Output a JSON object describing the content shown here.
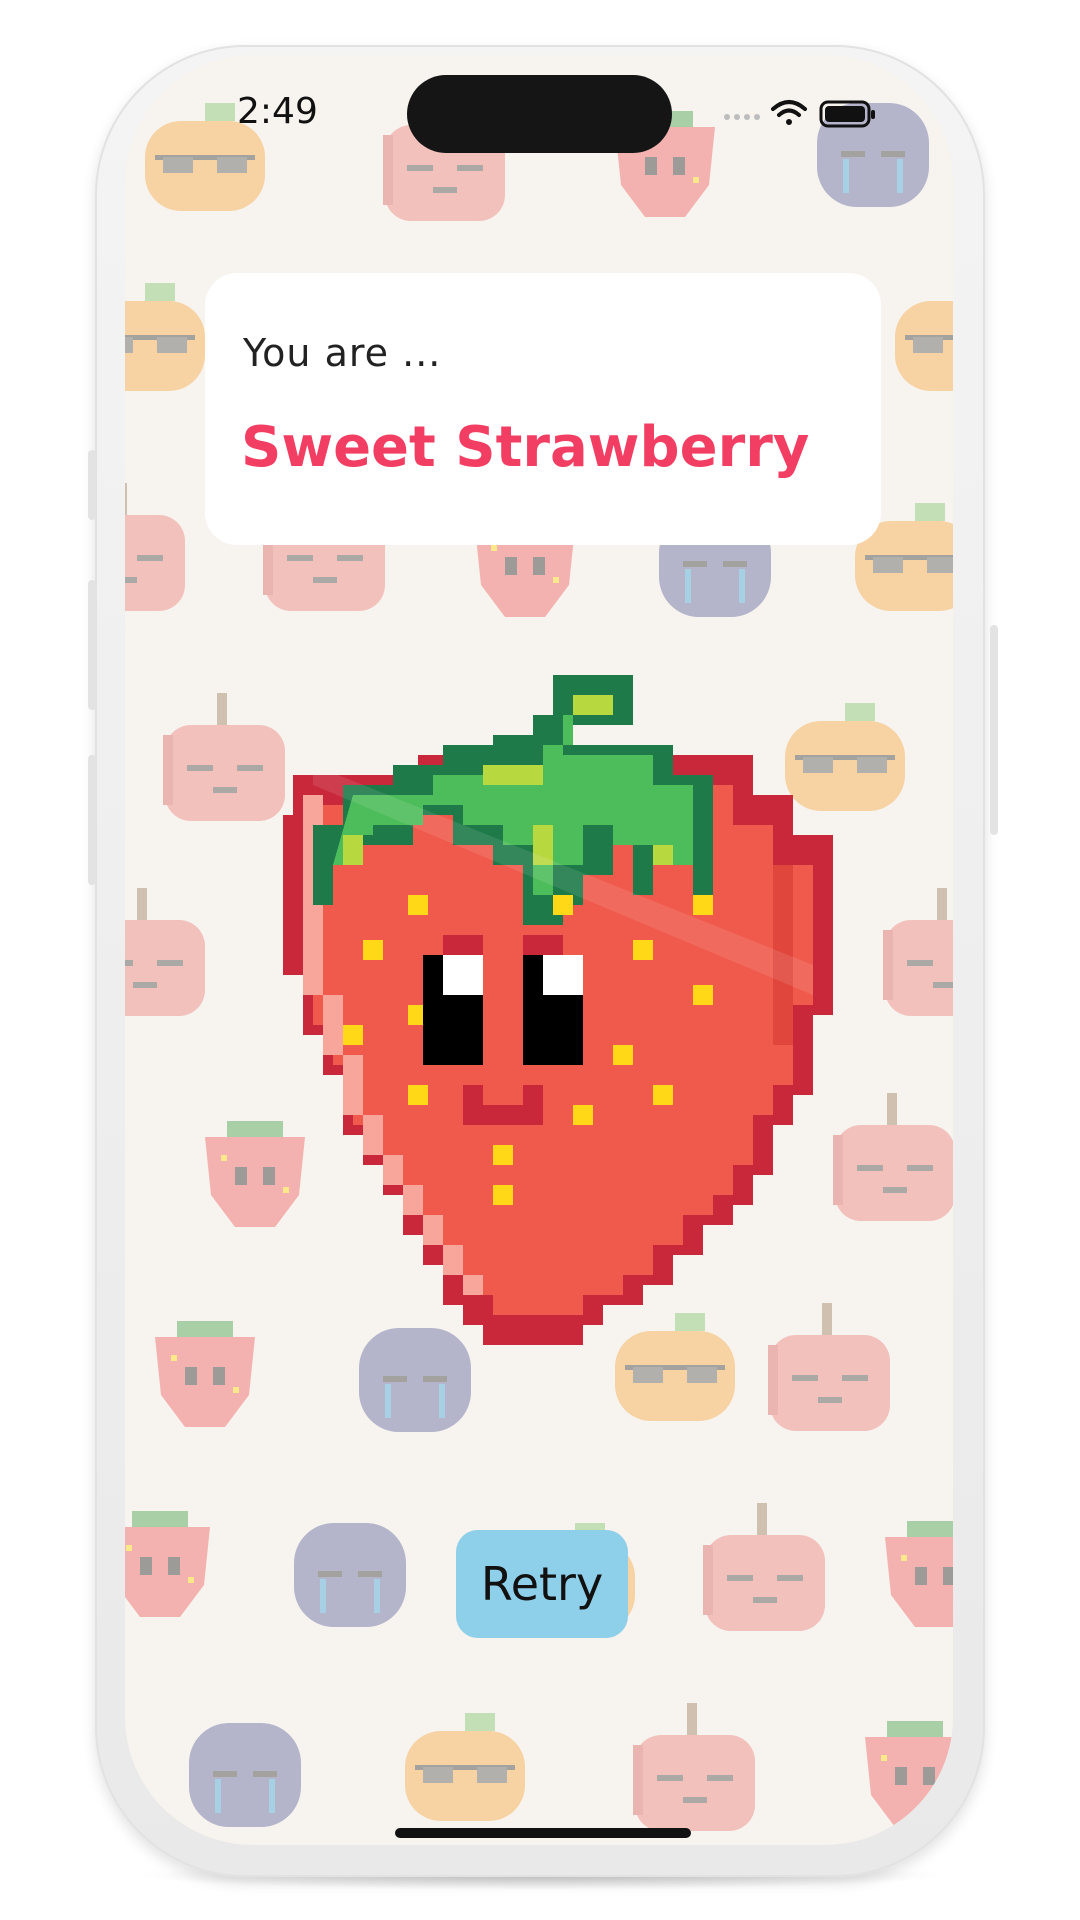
{
  "status_bar": {
    "time": "2:49",
    "icons": [
      "cellular-dots-icon",
      "wifi-icon",
      "battery-icon"
    ]
  },
  "result": {
    "prefix": "You are ...",
    "title": "Sweet Strawberry"
  },
  "hero_image": "strawberry-pixel-icon",
  "actions": {
    "retry_label": "Retry"
  },
  "background_pattern": [
    "apple-pixel-icon",
    "strawberry-pixel-icon",
    "orange-sunglasses-pixel-icon",
    "blueberry-crying-pixel-icon"
  ],
  "colors": {
    "title": "#f23e62",
    "retry_button": "#8ecfe9",
    "screen_background": "#f7f3ee"
  }
}
